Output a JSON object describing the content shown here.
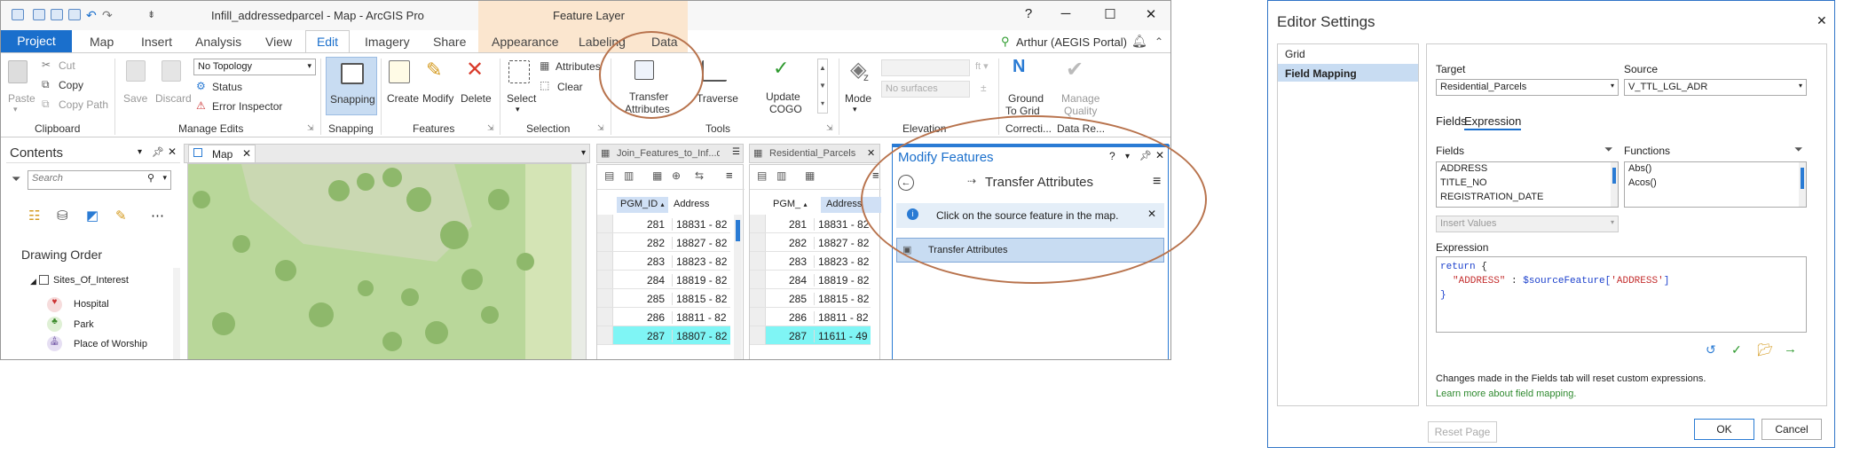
{
  "titlebar": {
    "doc_title": "Infill_addressedparcel - Map - ArcGIS Pro",
    "context_tab": "Feature Layer",
    "help": "?",
    "minimize": "─",
    "maximize": "☐",
    "close": "✕"
  },
  "tabs": [
    "Project",
    "Map",
    "Insert",
    "Analysis",
    "View",
    "Edit",
    "Imagery",
    "Share",
    "Appearance",
    "Labeling",
    "Data"
  ],
  "user": "Arthur (AEGIS Portal)",
  "ribbon": {
    "clipboard": {
      "paste": "Paste",
      "cut": "Cut",
      "copy": "Copy",
      "copy_path": "Copy Path",
      "label": "Clipboard"
    },
    "manage_edits": {
      "save": "Save",
      "discard": "Discard",
      "topology": "No Topology",
      "status": "Status",
      "error_inspector": "Error Inspector",
      "label": "Manage Edits"
    },
    "snapping": {
      "snapping": "Snapping",
      "label": "Snapping"
    },
    "features": {
      "create": "Create",
      "modify": "Modify",
      "delete": "Delete",
      "label": "Features"
    },
    "selection": {
      "select": "Select",
      "attributes": "Attributes",
      "clear": "Clear",
      "label": "Selection"
    },
    "tools": {
      "transfer1": "Transfer",
      "transfer2": "Attributes",
      "traverse": "Traverse",
      "update1": "Update",
      "update2": "COGO",
      "label": "Tools"
    },
    "elevation": {
      "mode": "Mode",
      "surfaces": "No surfaces",
      "label": "Elevation"
    },
    "correction": {
      "ground1": "Ground",
      "ground2": "To Grid",
      "label": "Correcti..."
    },
    "data_review": {
      "manage1": "Manage",
      "manage2": "Quality",
      "label": "Data Re..."
    }
  },
  "contents": {
    "title": "Contents",
    "search_placeholder": "Search",
    "drawing_order": "Drawing Order",
    "layer_group": "Sites_Of_Interest",
    "items": [
      "Hospital",
      "Park",
      "Place of Worship"
    ]
  },
  "map_tab": "Map",
  "table1": {
    "tab": "Join_Features_to_Inf...dr",
    "col1": "PGM_ID",
    "col2": "Address",
    "rows": [
      [
        "281",
        "18831 - 82"
      ],
      [
        "282",
        "18827 - 82"
      ],
      [
        "283",
        "18823 - 82"
      ],
      [
        "284",
        "18819 - 82"
      ],
      [
        "285",
        "18815 - 82"
      ],
      [
        "286",
        "18811 - 82"
      ],
      [
        "287",
        "18807 - 82"
      ]
    ]
  },
  "table2": {
    "tab": "Residential_Parcels",
    "col1": "PGM_",
    "col2": "Address",
    "rows": [
      [
        "281",
        "18831 - 82"
      ],
      [
        "282",
        "18827 - 82"
      ],
      [
        "283",
        "18823 - 82"
      ],
      [
        "284",
        "18819 - 82"
      ],
      [
        "285",
        "18815 - 82"
      ],
      [
        "286",
        "18811 - 82"
      ],
      [
        "287",
        "11611 - 49"
      ]
    ]
  },
  "modify": {
    "title": "Modify Features",
    "tool": "Transfer Attributes",
    "info": "Click on the source feature in the map.",
    "item": "Transfer Attributes",
    "help": "?"
  },
  "editor": {
    "title": "Editor Settings",
    "nav": [
      "Grid",
      "Field Mapping"
    ],
    "target_label": "Target",
    "target_value": "Residential_Parcels",
    "source_label": "Source",
    "source_value": "V_TTL_LGL_ADR",
    "tab_fields": "Fields",
    "tab_expression": "Expression",
    "fields_label": "Fields",
    "fields": [
      "ADDRESS",
      "TITLE_NO",
      "REGISTRATION_DATE"
    ],
    "functions_label": "Functions",
    "functions": [
      "Abs()",
      "Acos()"
    ],
    "insert_values": "Insert Values",
    "expression_label": "Expression",
    "expr_line1_kw": "return",
    "expr_line1_rest": " {",
    "expr_line2_key": "\"ADDRESS\"",
    "expr_line2_sep": " : ",
    "expr_line2_var": "$sourceFeature[",
    "expr_line2_str": "'ADDRESS'",
    "expr_line2_end": "]",
    "expr_line3": "}",
    "note": "Changes made in the Fields tab will reset custom expressions.",
    "link": "Learn more about field mapping.",
    "reset": "Reset Page",
    "ok": "OK",
    "cancel": "Cancel"
  },
  "colors": {
    "accent": "#1a6fcc",
    "context_tab": "#fbe6cf",
    "highlight_row": "#7ff5f5",
    "annotation": "#b8734d",
    "map_green": "#b9d79a"
  }
}
